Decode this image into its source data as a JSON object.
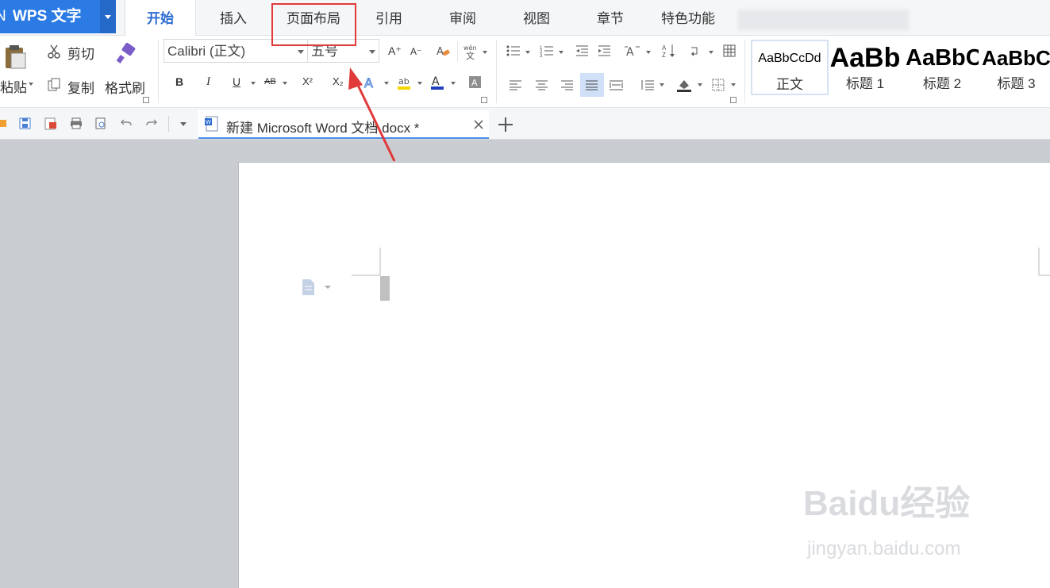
{
  "app": {
    "title": "WPS 文字",
    "left_glyph": "N"
  },
  "menu_tabs": [
    {
      "label": "开始",
      "active": true
    },
    {
      "label": "插入"
    },
    {
      "label": "页面布局",
      "highlighted": true
    },
    {
      "label": "引用"
    },
    {
      "label": "审阅"
    },
    {
      "label": "视图"
    },
    {
      "label": "章节"
    },
    {
      "label": "特色功能"
    }
  ],
  "clipboard": {
    "paste_label": "粘贴",
    "cut_label": "剪切",
    "copy_label": "复制",
    "format_painter_label": "格式刷"
  },
  "font": {
    "family_value": "Calibri (正文)",
    "size_value": "五号"
  },
  "formatting": {
    "bold": "B",
    "italic": "I",
    "underline": "U",
    "strike": "AB",
    "superscript": "X²",
    "subscript": "X₂",
    "grow": "A⁺",
    "shrink": "A⁻"
  },
  "styles": [
    {
      "preview": "AaBbCcDd",
      "name": "正文"
    },
    {
      "preview": "AaBb",
      "name": "标题 1"
    },
    {
      "preview": "AaBbC",
      "name": "标题 2"
    },
    {
      "preview": "AaBbC",
      "name": "标题 3"
    }
  ],
  "document_tab": {
    "title": "新建 Microsoft Word 文档.docx *"
  },
  "watermark": {
    "main": "Baidu经验",
    "sub": "jingyan.baidu.com"
  },
  "colors": {
    "accent": "#2c7be5",
    "annotation": "#e03a3a",
    "highlight_yellow": "#f2d600",
    "font_color": "#1f3fbf"
  }
}
